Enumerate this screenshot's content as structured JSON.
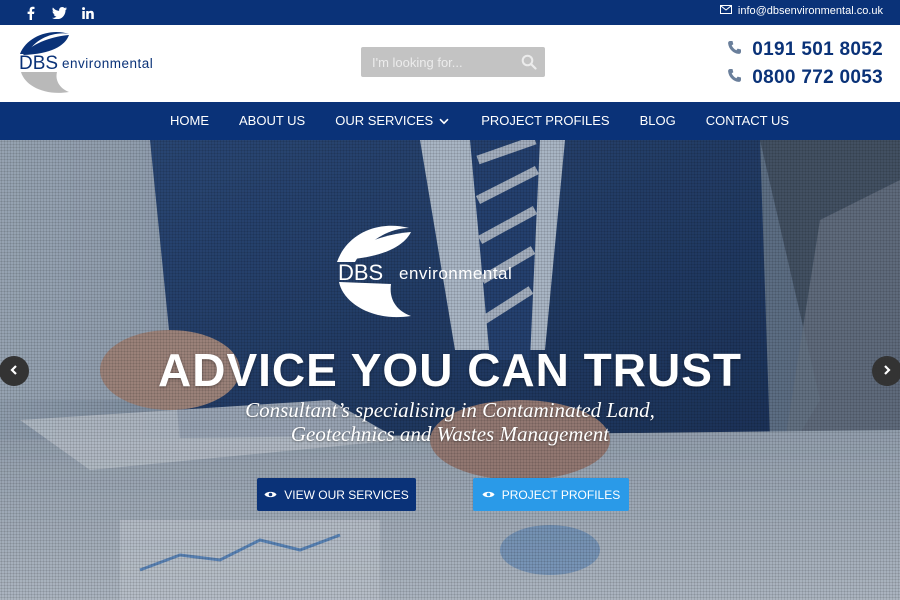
{
  "topbar": {
    "social_icons": [
      "facebook-icon",
      "twitter-icon",
      "linkedin-icon"
    ],
    "email": "info@dbsenvironmental.co.uk"
  },
  "header": {
    "logo_text": "DBS environmental",
    "search_placeholder": "I'm looking for...",
    "phones": [
      "0191 501 8052",
      "0800 772 0053"
    ]
  },
  "nav": {
    "items": [
      "HOME",
      "ABOUT US",
      "OUR SERVICES",
      "PROJECT PROFILES",
      "BLOG",
      "CONTACT US"
    ]
  },
  "hero": {
    "logo_text": "DBS environmental",
    "headline": "ADVICE YOU CAN TRUST",
    "subline_1": "Consultant’s specialising in Contaminated Land,",
    "subline_2": "Geotechnics and Wastes Management",
    "button_services": "VIEW OUR SERVICES",
    "button_profiles": "PROJECT PROFILES"
  },
  "colors": {
    "brand_navy": "#0a3278",
    "accent_blue": "#2a9ae8",
    "search_grey": "#c3c3c3"
  }
}
